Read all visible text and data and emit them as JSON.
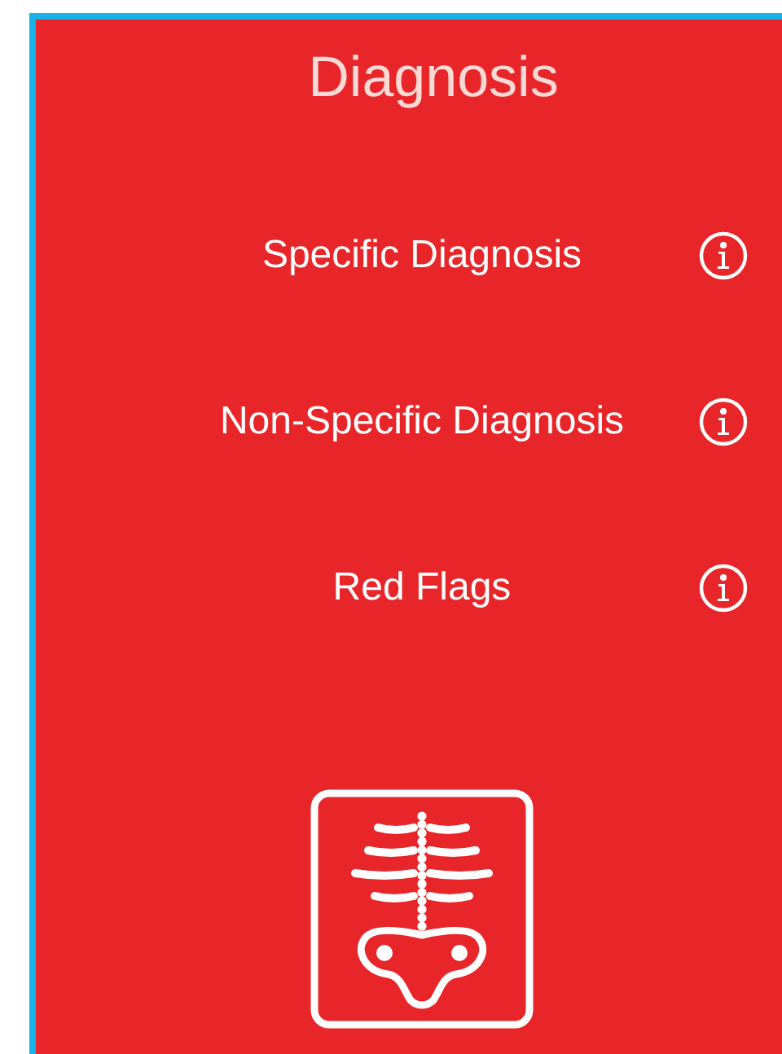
{
  "title": "Diagnosis",
  "items": [
    {
      "label": "Specific Diagnosis"
    },
    {
      "label": "Non-Specific Diagnosis"
    },
    {
      "label": "Red Flags"
    }
  ]
}
